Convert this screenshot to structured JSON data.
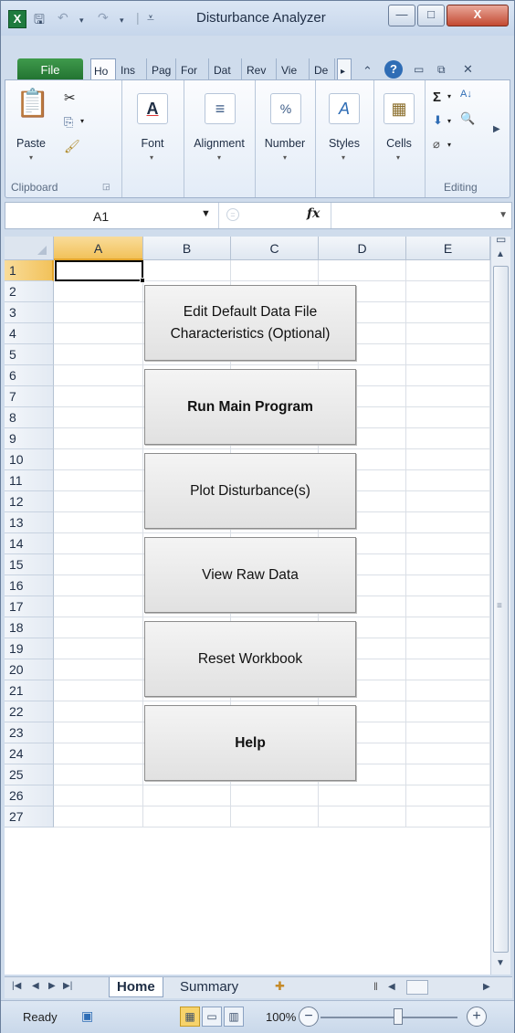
{
  "window": {
    "title": "Disturbance Analyzer",
    "minimize": "—",
    "maximize": "□",
    "close": "X"
  },
  "qat": {
    "app_icon": "X",
    "save": "🖫",
    "undo": "↶",
    "redo": "↷",
    "customize": "⩡"
  },
  "ribbon_tabs": {
    "file": "File",
    "tabs": [
      "Ho",
      "Ins",
      "Pag",
      "For",
      "Dat",
      "Rev",
      "Vie",
      "De"
    ],
    "more": "▸",
    "help": "?"
  },
  "ribbon": {
    "clipboard": {
      "paste": "Paste",
      "label": "Clipboard"
    },
    "font": {
      "label": "Font",
      "icon": "A"
    },
    "alignment": {
      "label": "Alignment",
      "icon": "≡"
    },
    "number": {
      "label": "Number",
      "icon": "%"
    },
    "styles": {
      "label": "Styles",
      "icon": "A"
    },
    "cells": {
      "label": "Cells",
      "icon": "▦"
    },
    "editing": {
      "label": "Editing",
      "sigma": "Σ",
      "sort": "A↓",
      "find": "🔍"
    }
  },
  "formula_bar": {
    "name_box": "A1",
    "fx": "fx",
    "value": ""
  },
  "sheet": {
    "columns": [
      "A",
      "B",
      "C",
      "D",
      "E"
    ],
    "rows": [
      "1",
      "2",
      "3",
      "4",
      "5",
      "6",
      "7",
      "8",
      "9",
      "10",
      "11",
      "12",
      "13",
      "14",
      "15",
      "16",
      "17",
      "18",
      "19",
      "20",
      "21",
      "22",
      "23",
      "24",
      "25",
      "26",
      "27"
    ],
    "selected_cell": "A1",
    "buttons": [
      {
        "label": "Edit Default Data File Characteristics (Optional)",
        "bold": false
      },
      {
        "label": "Run Main Program",
        "bold": true
      },
      {
        "label": "Plot Disturbance(s)",
        "bold": false
      },
      {
        "label": "View Raw Data",
        "bold": false
      },
      {
        "label": "Reset Workbook",
        "bold": false
      },
      {
        "label": "Help",
        "bold": true
      }
    ]
  },
  "sheet_tabs": [
    "Home",
    "Summary"
  ],
  "active_sheet": "Home",
  "status": {
    "ready": "Ready",
    "zoom": "100%"
  }
}
